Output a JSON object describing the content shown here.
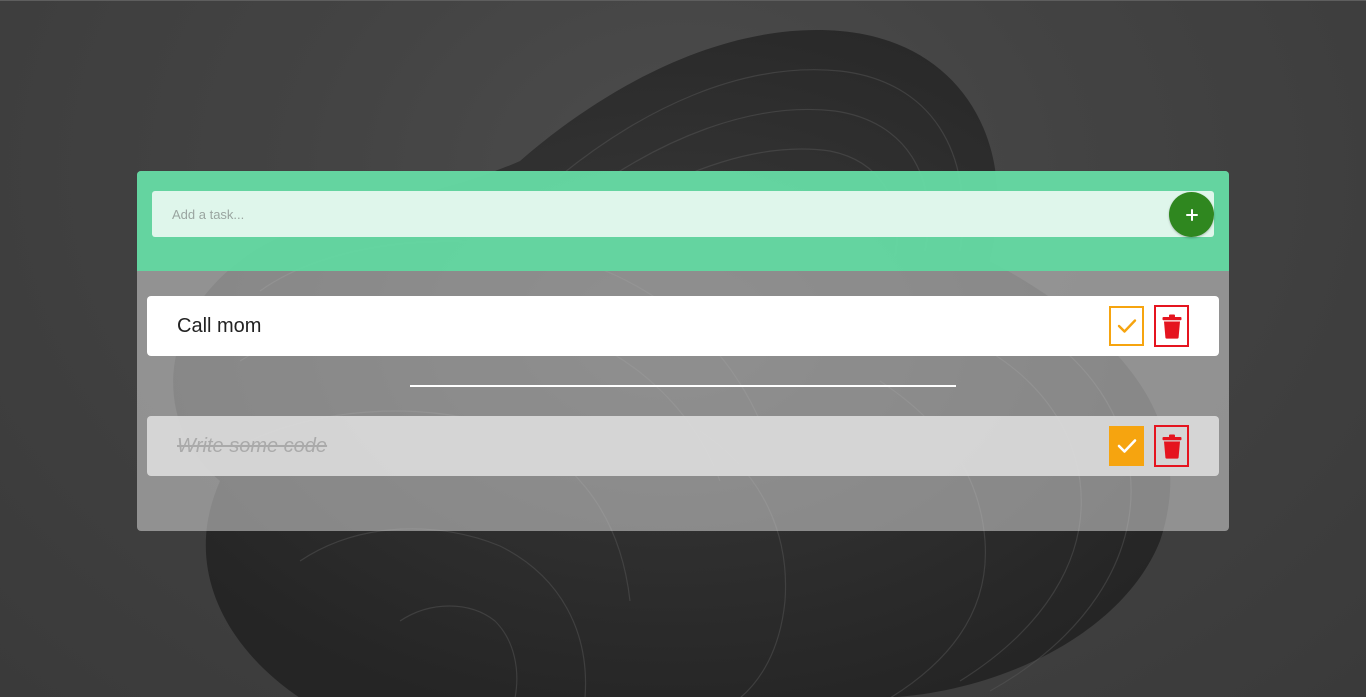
{
  "background": {
    "icon": "abstract-swirl-wallpaper"
  },
  "new_task": {
    "placeholder": "Add a task...",
    "value": "",
    "add_icon": "plus-icon",
    "accent": "#2f871f"
  },
  "tasks": [
    {
      "text": "Call mom",
      "completed": false,
      "check_icon": "check-icon",
      "delete_icon": "trash-icon"
    },
    {
      "text": "Write some code",
      "completed": true,
      "check_icon": "check-icon",
      "delete_icon": "trash-icon"
    }
  ],
  "colors": {
    "header": "#62d6a0",
    "check": "#f6a40f",
    "delete": "#e5141f"
  }
}
